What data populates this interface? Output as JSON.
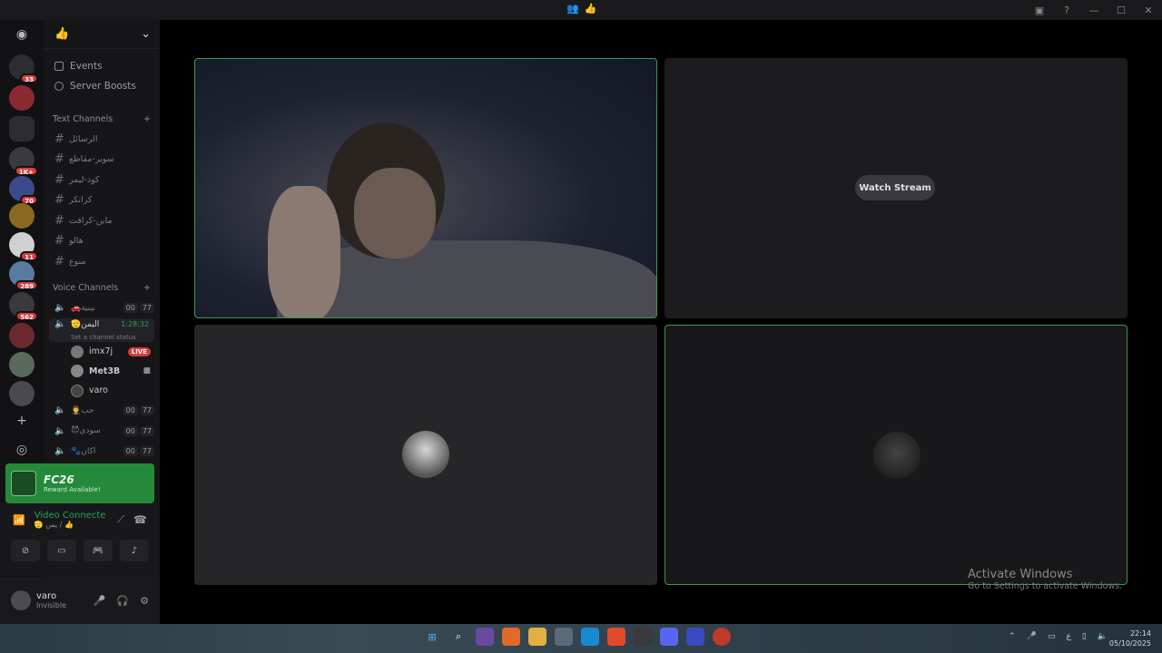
{
  "titlebar": {
    "center_icons": [
      "people-icon",
      "hand-emoji"
    ],
    "buttons": [
      "inbox-icon",
      "help-icon",
      "minimize",
      "maximize",
      "close"
    ]
  },
  "rail": {
    "badges": [
      "33",
      "1K+",
      "70",
      "11",
      "289",
      "562"
    ]
  },
  "server": {
    "name": "👍",
    "nav": [
      "Events",
      "Server Boosts"
    ],
    "text_section": "Text Channels",
    "text_channels": [
      "الرسائل",
      "سوير-مقاطع",
      "كود-ليمر",
      "كرانكر",
      "ماين-كرافت",
      "هالو",
      "منوع"
    ],
    "voice_section": "Voice Channels",
    "voice_channels": [
      {
        "name": "🚗بينية",
        "a": "00",
        "b": "77"
      },
      {
        "name": "🫡اليمن",
        "time": "1:28:32",
        "status": "Set a channel status"
      },
      {
        "name": "🤵‍♂️حب",
        "a": "00",
        "b": "77"
      },
      {
        "name": "😈سودي",
        "a": "00",
        "b": "77"
      },
      {
        "name": "🐾اكان",
        "a": "00",
        "b": "77"
      }
    ],
    "members": [
      {
        "name": "imx7j",
        "badge": "LIVE"
      },
      {
        "name": "Met3B",
        "badge": ""
      },
      {
        "name": "varo",
        "badge": ""
      }
    ]
  },
  "promo": {
    "title": "FC26",
    "subtitle": "Reward Available!"
  },
  "voice_panel": {
    "title": "Video Connecte",
    "subtitle": "🫡 يمن / 👍"
  },
  "user": {
    "name": "varo",
    "status": "Invisible"
  },
  "stage": {
    "watch_label": "Watch Stream"
  },
  "watermark": {
    "title": "Activate Windows",
    "subtitle": "Go to Settings to activate Windows."
  },
  "taskbar": {
    "time": "22:14",
    "date": "05/10/2025"
  },
  "colors": {
    "accent_green": "#3a9a4a",
    "live_red": "#d83c3e",
    "promo_green": "#248a3a"
  }
}
